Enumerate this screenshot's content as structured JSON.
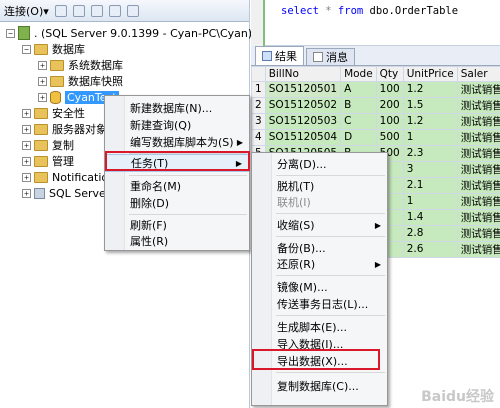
{
  "toolbar": {
    "connect_label": "连接(O)▾"
  },
  "tree": {
    "server": ". (SQL Server 9.0.1399 - Cyan-PC\\Cyan)",
    "databases": "数据库",
    "system_databases": "系统数据库",
    "snapshots": "数据库快照",
    "cyantest": "CyanTest",
    "security": "安全性",
    "server_objects": "服务器对象",
    "replication": "复制",
    "management": "管理",
    "notification": "Notification",
    "sql_server": "SQL Server"
  },
  "editor": {
    "kw_select": "select",
    "star": "*",
    "kw_from": "from",
    "table": "dbo.OrderTable"
  },
  "tabs": {
    "results": "结果",
    "messages": "消息"
  },
  "grid": {
    "columns": [
      "",
      "BillNo",
      "Mode",
      "Qty",
      "UnitPrice",
      "Saler"
    ],
    "rows": [
      [
        "1",
        "SO15120501",
        "A",
        "100",
        "1.2",
        "测试销售员"
      ],
      [
        "2",
        "SO15120502",
        "B",
        "200",
        "1.5",
        "测试销售员"
      ],
      [
        "3",
        "SO15120503",
        "C",
        "100",
        "1.2",
        "测试销售员"
      ],
      [
        "4",
        "SO15120504",
        "D",
        "500",
        "1",
        "测试销售员"
      ],
      [
        "5",
        "SO15120505",
        "B",
        "500",
        "2.3",
        "测试销售员"
      ],
      [
        "",
        "",
        "",
        "",
        "3",
        "测试销售员"
      ],
      [
        "",
        "",
        "",
        "",
        "2.1",
        "测试销售员"
      ],
      [
        "",
        "",
        "",
        "",
        "1",
        "测试销售员"
      ],
      [
        "",
        "",
        "",
        "",
        "1.4",
        "测试销售员"
      ],
      [
        "",
        "",
        "",
        "",
        "2.8",
        "测试销售员"
      ],
      [
        "",
        "",
        "",
        "",
        "2.6",
        "测试销售员"
      ]
    ]
  },
  "menu1": {
    "items": [
      "新建数据库(N)...",
      "新建查询(Q)",
      "编写数据库脚本为(S)",
      "任务(T)",
      "重命名(M)",
      "删除(D)",
      "刷新(F)",
      "属性(R)"
    ]
  },
  "menu2": {
    "items": [
      "分离(D)...",
      "脱机(T)",
      "联机(I)",
      "收缩(S)",
      "备份(B)...",
      "还原(R)",
      "镜像(M)...",
      "传送事务日志(L)...",
      "生成脚本(E)...",
      "导入数据(I)...",
      "导出数据(X)...",
      "复制数据库(C)..."
    ]
  },
  "watermark": "Baidu经验"
}
